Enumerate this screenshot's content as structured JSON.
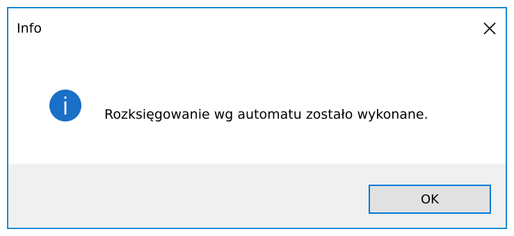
{
  "window": {
    "title": "Info",
    "close_icon": "close-icon",
    "border_color": "#1a8ad4"
  },
  "message": {
    "icon": "info-icon",
    "icon_color": "#1a6fc6",
    "text": "Rozksięgowanie wg automatu zostało wykonane."
  },
  "footer": {
    "background": "#f0f0f0",
    "ok_label": "OK",
    "ok_border_color": "#0078d7"
  }
}
